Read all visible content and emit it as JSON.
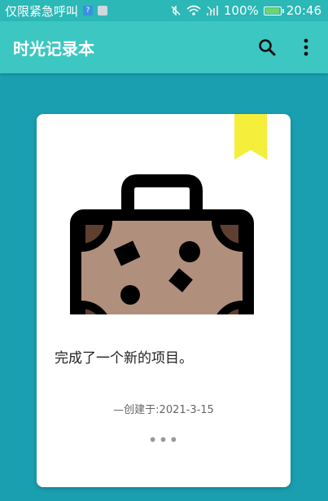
{
  "statusbar": {
    "carrier": "仅限紧急呼叫",
    "battery_pct": "100%",
    "time": "20:46",
    "battery_level": 1.0
  },
  "appbar": {
    "title": "时光记录本",
    "search_icon": "search-icon",
    "menu_icon": "more-vert-icon"
  },
  "card": {
    "text": "完成了一个新的项目。",
    "created_prefix": "—创建于:",
    "created_date": "2021-3-15",
    "more": "•••",
    "illustration_icon": "suitcase-icon",
    "bookmark_color": "#f5ee3a"
  },
  "colors": {
    "background": "#1a9fb0",
    "appbar": "#3cc7c2",
    "statusbar": "#2bb8b6"
  }
}
